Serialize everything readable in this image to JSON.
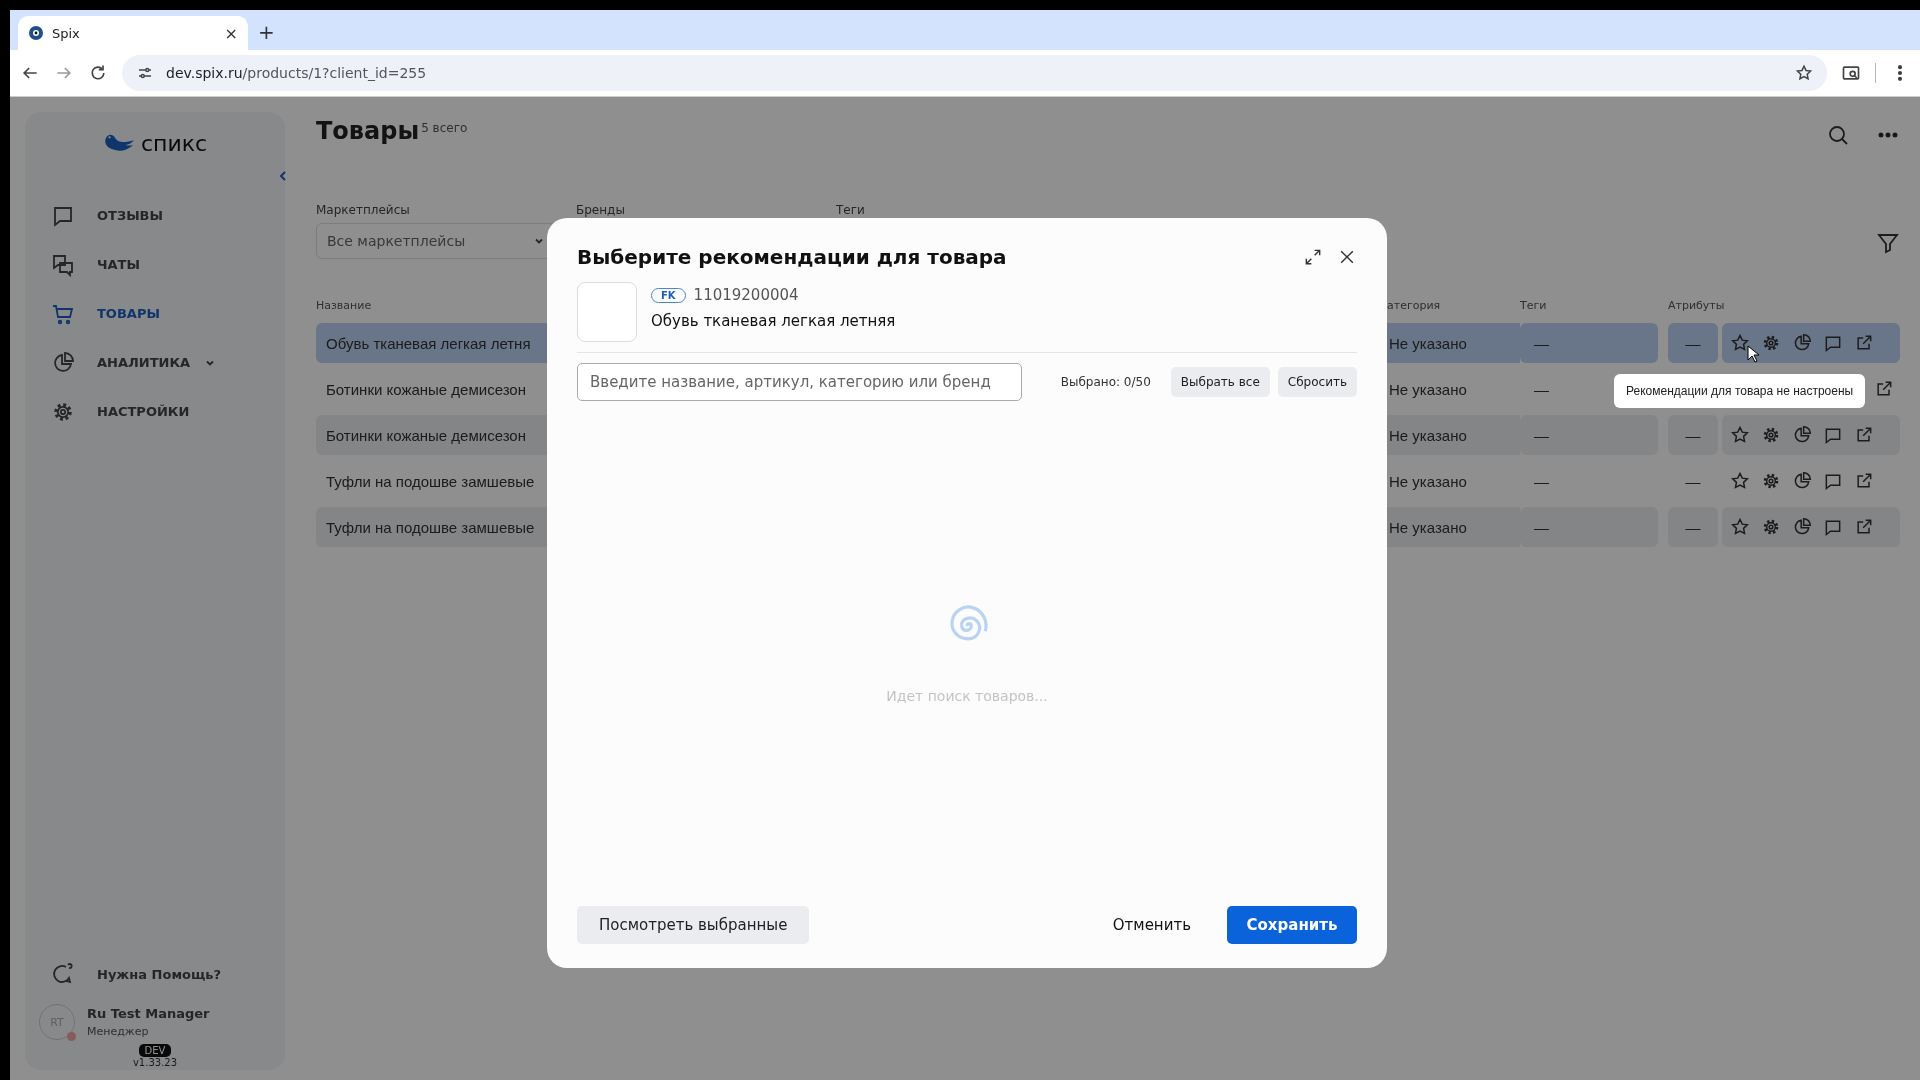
{
  "browser": {
    "tab_title": "Spix",
    "tab_close": "×",
    "new_tab": "+",
    "url_host": "dev.spix.ru",
    "url_path": "/products/1?client_id=255"
  },
  "sidebar": {
    "logo_text": "спикс",
    "items": [
      {
        "label": "ОТЗЫВЫ",
        "selected": false,
        "has_submenu": false
      },
      {
        "label": "ЧАТЫ",
        "selected": false,
        "has_submenu": false
      },
      {
        "label": "ТОВАРЫ",
        "selected": true,
        "has_submenu": false
      },
      {
        "label": "АНАЛИТИКА",
        "selected": false,
        "has_submenu": true
      },
      {
        "label": "НАСТРОЙКИ",
        "selected": false,
        "has_submenu": false
      }
    ],
    "help": "Нужна Помощь?",
    "user": {
      "initials": "RT",
      "name": "Ru Test Manager",
      "role": "Менеджер",
      "alert": true
    },
    "env_badge": "DEV",
    "version": "v1.33.23"
  },
  "page": {
    "title": "Товары",
    "count": "5 всего"
  },
  "filters": [
    {
      "label": "Маркетплейсы",
      "value": "Все маркетплейсы"
    },
    {
      "label": "Бренды"
    },
    {
      "label": "Теги"
    }
  ],
  "table": {
    "columns": [
      "Название",
      "атегория",
      "Теги",
      "Атрибуты"
    ],
    "rows": [
      {
        "name": "Обувь тканевая легкая летня",
        "category": "Не указано",
        "tags": "—",
        "attributes": "—",
        "hovered": true
      },
      {
        "name": "Ботинки кожаные демисезон",
        "category": "Не указано",
        "tags": "—",
        "hovered": false
      },
      {
        "name": "Ботинки кожаные демисезон",
        "category": "Не указано",
        "tags": "—",
        "attributes": "—",
        "hovered": false
      },
      {
        "name": "Туфли на подошве замшевые",
        "category": "Не указано",
        "tags": "—",
        "attributes": "—",
        "hovered": false
      },
      {
        "name": "Туфли на подошве замшевые",
        "category": "Не указано",
        "tags": "—",
        "attributes": "—",
        "hovered": false
      }
    ]
  },
  "tooltip": "Рекомендации для товара не настроены",
  "modal": {
    "title": "Выберите рекомендации для товара",
    "product": {
      "marketplace": "FK",
      "sku": "11019200004",
      "name": "Обувь тканевая легкая летняя"
    },
    "search": {
      "placeholder": "Введите название, артикул, категорию или бренд"
    },
    "selected_count": "Выбрано: 0/50",
    "select_all": "Выбрать все",
    "reset": "Сбросить",
    "loading_text": "Идет поиск товаров...",
    "view_selected": "Посмотреть выбранные",
    "cancel": "Отменить",
    "save": "Сохранить"
  }
}
